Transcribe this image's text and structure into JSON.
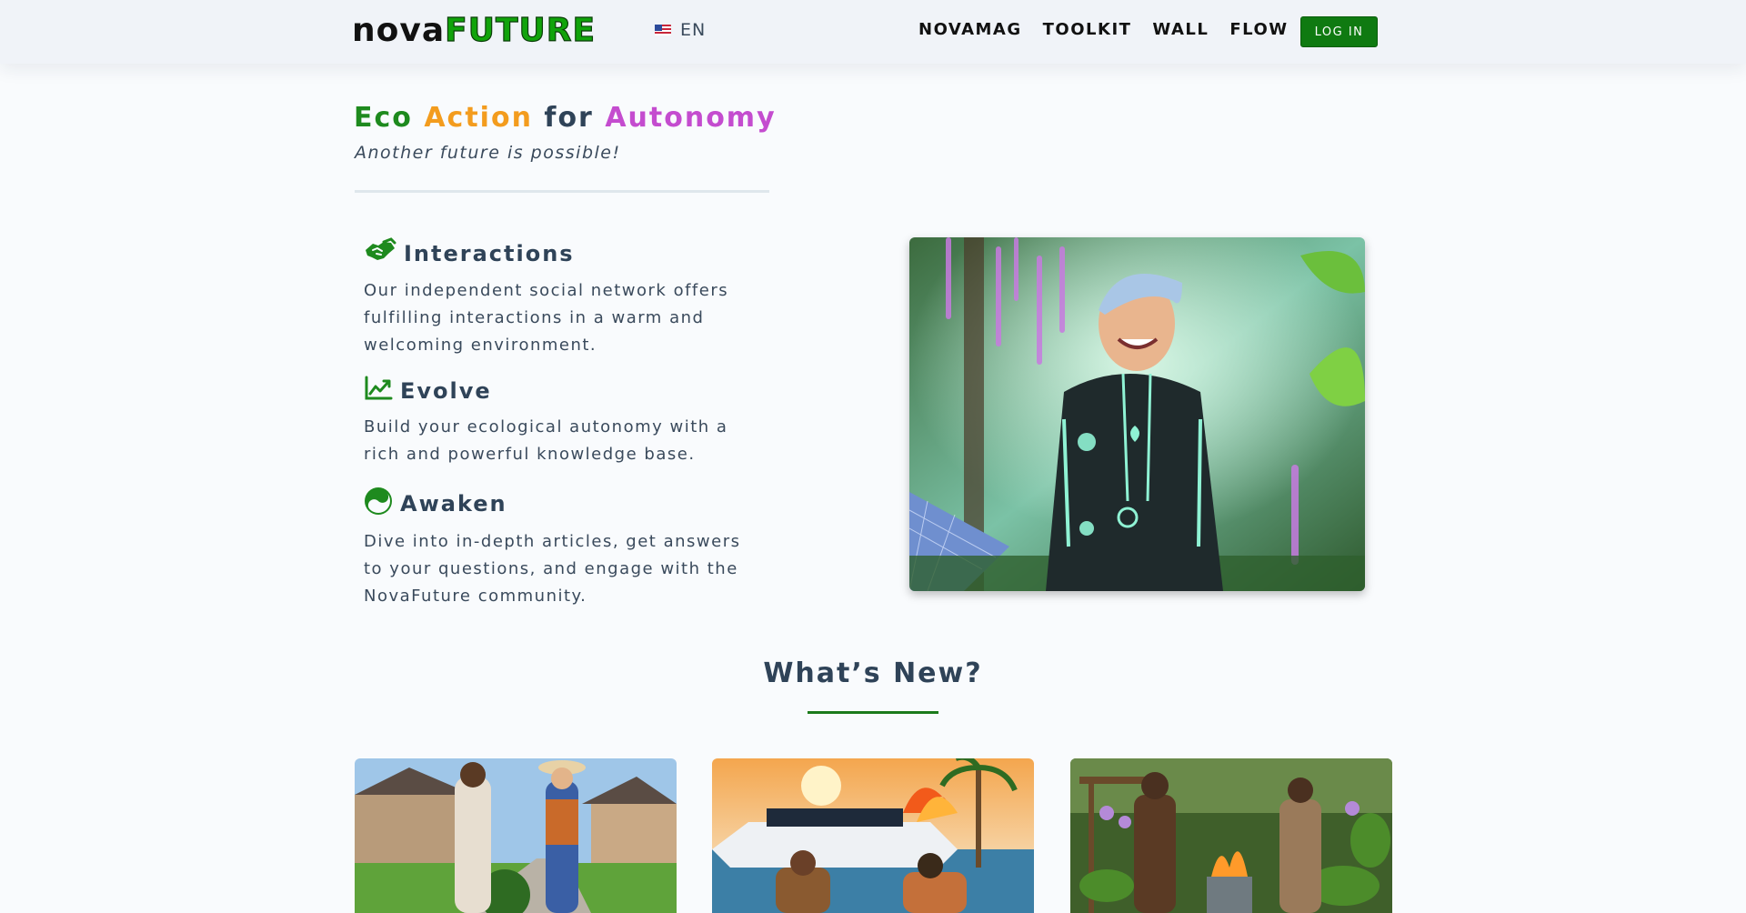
{
  "header": {
    "logo_part1": "nova",
    "logo_part2": "FUTURE",
    "language": "EN",
    "nav": [
      "NOVAMAG",
      "TOOLKIT",
      "WALL",
      "FLOW"
    ],
    "login_label": "LOG IN"
  },
  "hero": {
    "headline": [
      "Eco",
      "Action",
      "for",
      "Autonomy"
    ],
    "tagline": "Another future is possible!"
  },
  "features": [
    {
      "icon": "handshake-icon",
      "title": "Interactions",
      "description": "Our independent social network offers fulfilling interactions in a warm and welcoming environment."
    },
    {
      "icon": "chart-line-icon",
      "title": "Evolve",
      "description": "Build your ecological autonomy with a rich and powerful knowledge base."
    },
    {
      "icon": "yin-yang-icon",
      "title": "Awaken",
      "description": "Dive into in-depth articles, get answers to your questions, and engage with the NovaFuture community."
    }
  ],
  "whats_new": {
    "title": "What’s New?"
  },
  "colors": {
    "brand_green": "#0f7a11",
    "eco": "#1e8a1e",
    "action": "#f39c1e",
    "autonomy": "#c44ccf"
  }
}
